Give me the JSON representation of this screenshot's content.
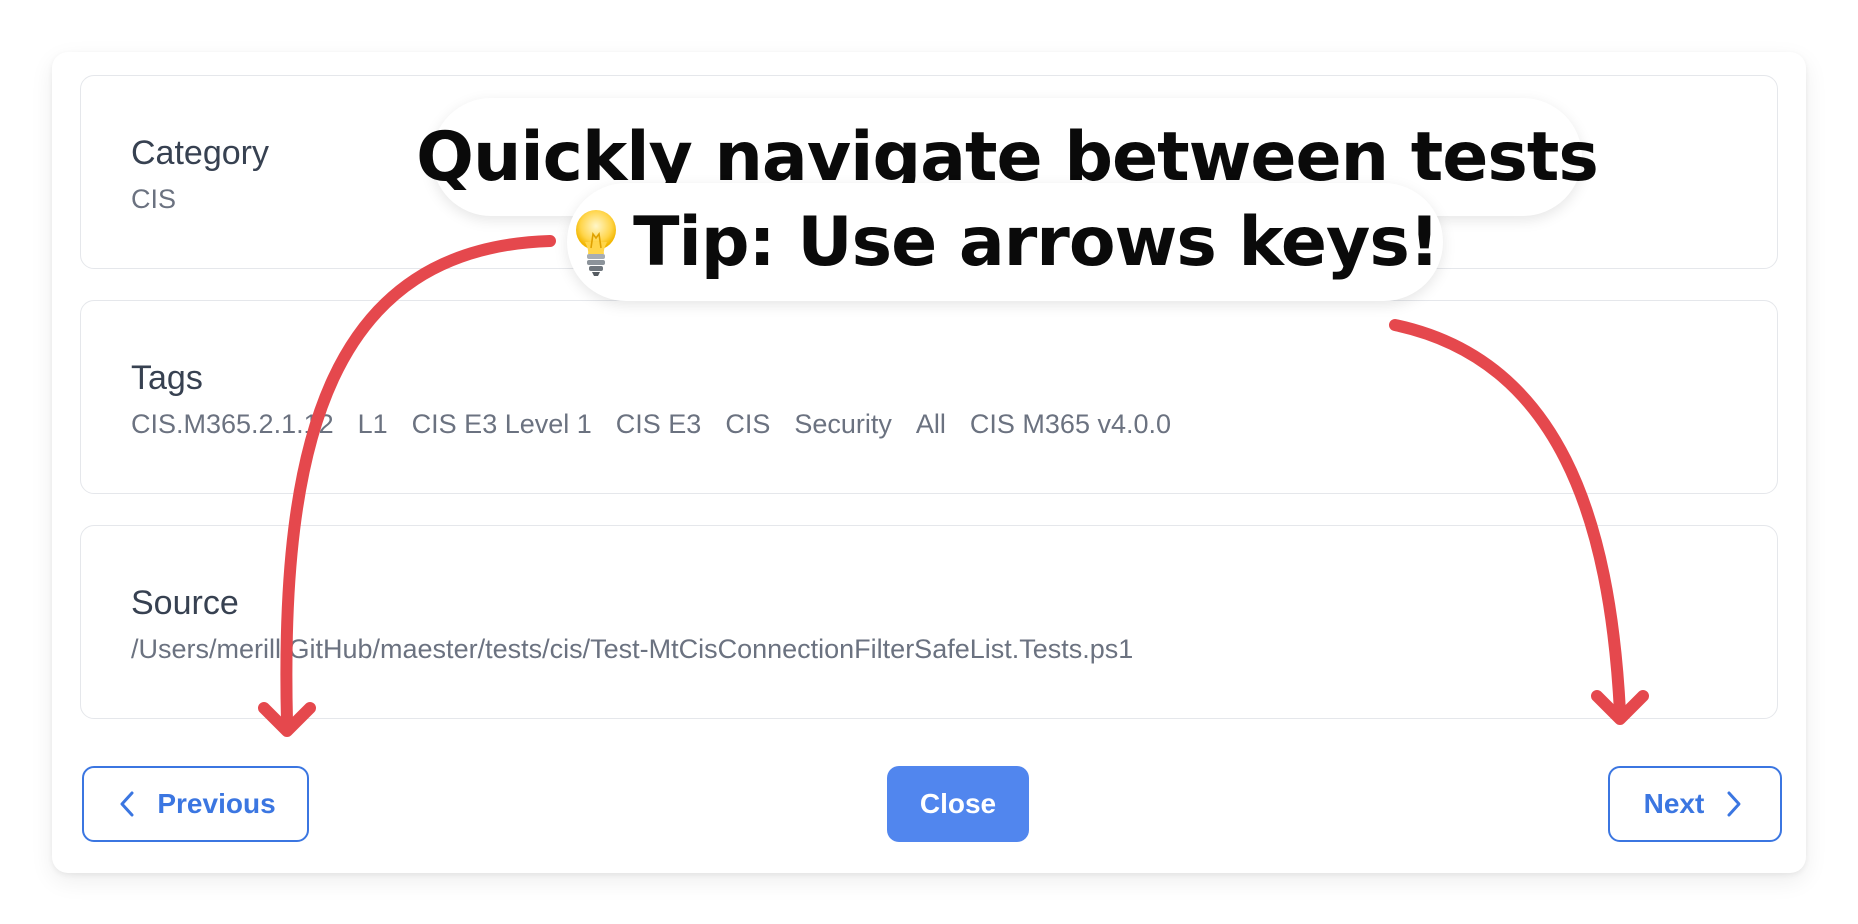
{
  "category": {
    "title": "Category",
    "value": "CIS"
  },
  "tags": {
    "title": "Tags",
    "items": [
      "CIS.M365.2.1.12",
      "L1",
      "CIS E3 Level 1",
      "CIS E3",
      "CIS",
      "Security",
      "All",
      "CIS M365 v4.0.0"
    ]
  },
  "source": {
    "title": "Source",
    "path": "/Users/merill/GitHub/maester/tests/cis/Test-MtCisConnectionFilterSafeList.Tests.ps1"
  },
  "buttons": {
    "previous": "Previous",
    "close": "Close",
    "next": "Next"
  },
  "overlay": {
    "headline": "Quickly navigate  between tests",
    "tip": "Tip: Use arrows keys!",
    "tip_icon": "lightbulb-icon"
  },
  "colors": {
    "accent": "#3b76e1",
    "close_button": "#5186ee",
    "arrow": "#e5484d"
  }
}
